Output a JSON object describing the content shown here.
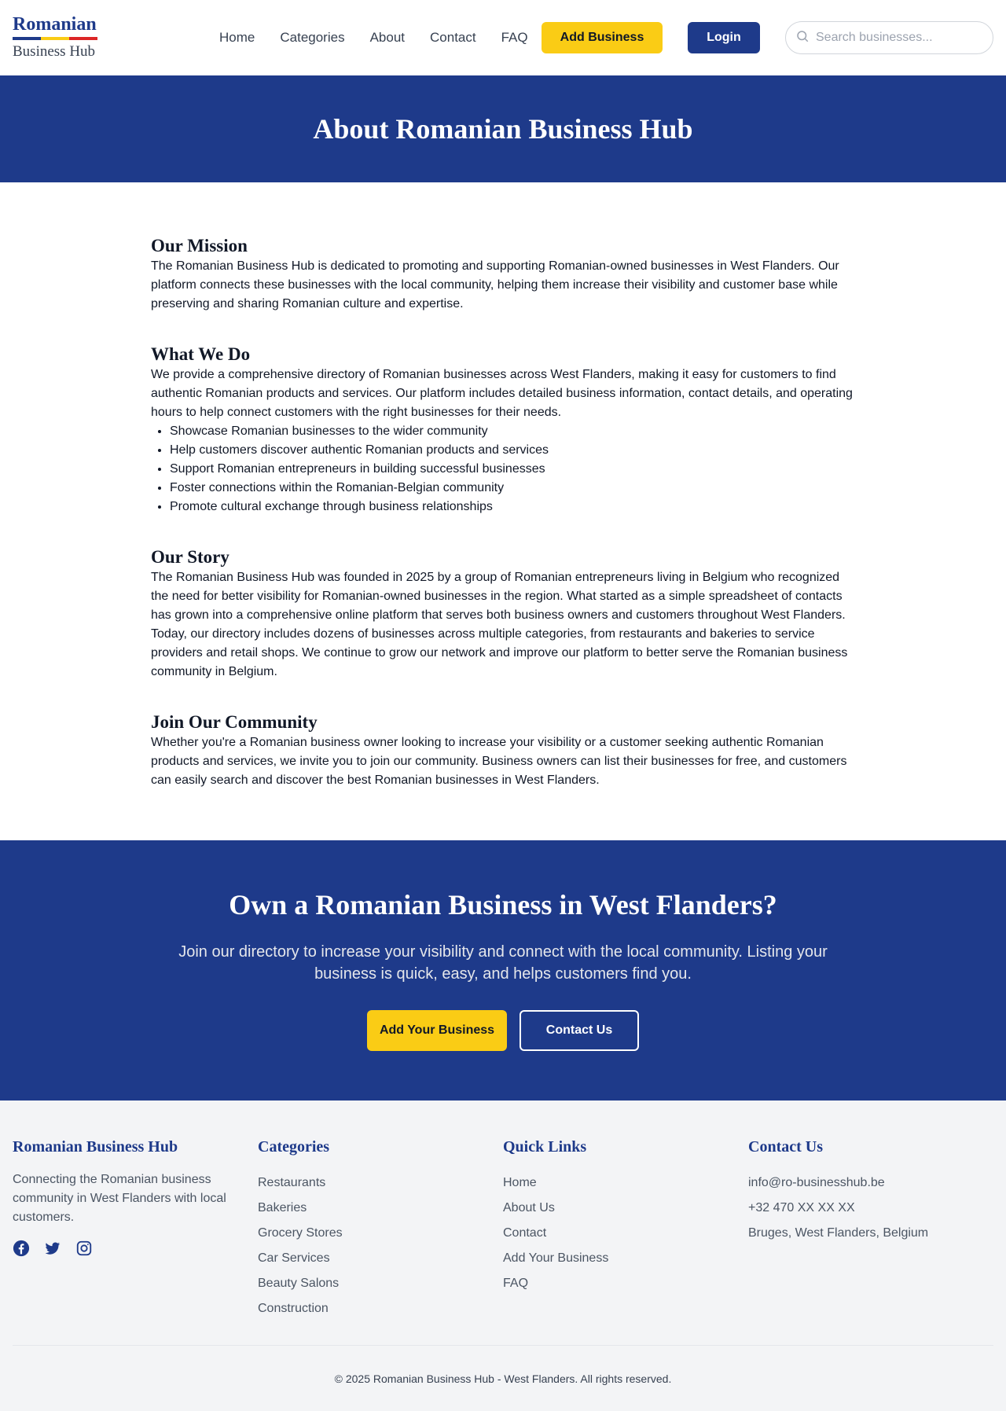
{
  "header": {
    "logo_title": "Romanian",
    "logo_subtitle": "Business Hub",
    "nav": [
      "Home",
      "Categories",
      "About",
      "Contact",
      "FAQ"
    ],
    "add_business_label": "Add Business",
    "login_label": "Login",
    "search_placeholder": "Search businesses..."
  },
  "colors": {
    "brand_blue": "#1e3a8a",
    "brand_yellow": "#facc15",
    "brand_red": "#dc2626"
  },
  "hero": {
    "title": "About Romanian Business Hub"
  },
  "sections": {
    "mission": {
      "title": "Our Mission",
      "text": "The Romanian Business Hub is dedicated to promoting and supporting Romanian-owned businesses in West Flanders. Our platform connects these businesses with the local community, helping them increase their visibility and customer base while preserving and sharing Romanian culture and expertise."
    },
    "what_we_do": {
      "title": "What We Do",
      "text": "We provide a comprehensive directory of Romanian businesses across West Flanders, making it easy for customers to find authentic Romanian products and services. Our platform includes detailed business information, contact details, and operating hours to help connect customers with the right businesses for their needs.",
      "items": [
        "Showcase Romanian businesses to the wider community",
        "Help customers discover authentic Romanian products and services",
        "Support Romanian entrepreneurs in building successful businesses",
        "Foster connections within the Romanian-Belgian community",
        "Promote cultural exchange through business relationships"
      ]
    },
    "story": {
      "title": "Our Story",
      "text": "The Romanian Business Hub was founded in 2025 by a group of Romanian entrepreneurs living in Belgium who recognized the need for better visibility for Romanian-owned businesses in the region. What started as a simple spreadsheet of contacts has grown into a comprehensive online platform that serves both business owners and customers throughout West Flanders. Today, our directory includes dozens of businesses across multiple categories, from restaurants and bakeries to service providers and retail shops. We continue to grow our network and improve our platform to better serve the Romanian business community in Belgium."
    },
    "community": {
      "title": "Join Our Community",
      "text": "Whether you're a Romanian business owner looking to increase your visibility or a customer seeking authentic Romanian products and services, we invite you to join our community. Business owners can list their businesses for free, and customers can easily search and discover the best Romanian businesses in West Flanders."
    }
  },
  "cta": {
    "title": "Own a Romanian Business in West Flanders?",
    "text": "Join our directory to increase your visibility and connect with the local community. Listing your business is quick, easy, and helps customers find you.",
    "add_label": "Add Your Business",
    "contact_label": "Contact Us"
  },
  "footer": {
    "about": {
      "title": "Romanian Business Hub",
      "text": "Connecting the Romanian business community in West Flanders with local customers.",
      "socials": [
        "facebook-icon",
        "twitter-icon",
        "instagram-icon"
      ]
    },
    "categories": {
      "title": "Categories",
      "items": [
        "Restaurants",
        "Bakeries",
        "Grocery Stores",
        "Car Services",
        "Beauty Salons",
        "Construction"
      ]
    },
    "quick_links": {
      "title": "Quick Links",
      "items": [
        "Home",
        "About Us",
        "Contact",
        "Add Your Business",
        "FAQ"
      ]
    },
    "contact": {
      "title": "Contact Us",
      "items": [
        "info@ro-businesshub.be",
        "+32 470 XX XX XX",
        "Bruges, West Flanders, Belgium"
      ]
    },
    "copyright": "© 2025 Romanian Business Hub - West Flanders. All rights reserved."
  }
}
